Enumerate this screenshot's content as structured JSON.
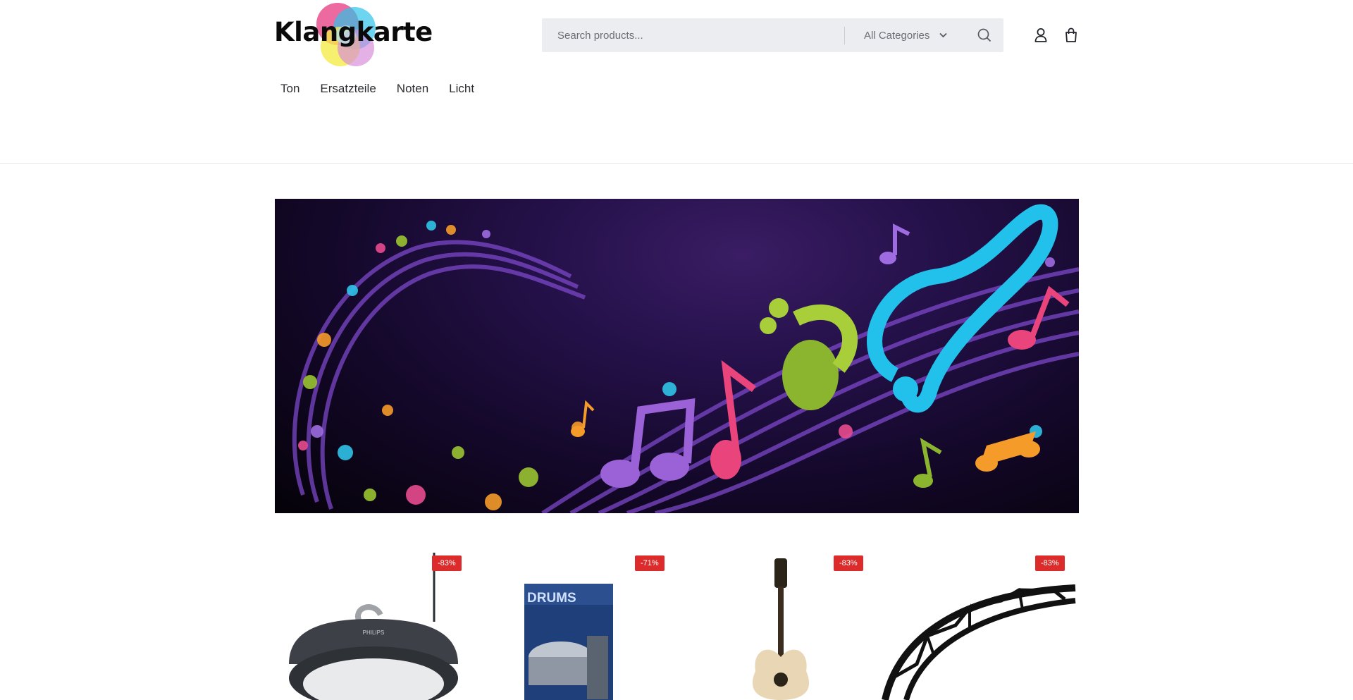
{
  "brand": {
    "name": "Klangkarte"
  },
  "search": {
    "placeholder": "Search products...",
    "category": "All Categories"
  },
  "icons": {
    "search": "search-icon",
    "account": "user-icon",
    "cart": "shopping-bag-icon",
    "dropdown": "chevron-down-icon"
  },
  "nav": {
    "items": [
      {
        "label": "Ton"
      },
      {
        "label": "Ersatzteile"
      },
      {
        "label": "Noten"
      },
      {
        "label": "Licht"
      }
    ]
  },
  "hero": {
    "theme": "colorful musical notes and treble clef on purple background"
  },
  "products": [
    {
      "discount": "-83%",
      "image": "industrial-led-high-bay-lamp"
    },
    {
      "discount": "-71%",
      "image": "drums-book-cover"
    },
    {
      "discount": "-83%",
      "image": "acoustic-guitar"
    },
    {
      "discount": "-83%",
      "image": "curved-truss-segment"
    }
  ],
  "colors": {
    "badge": "#dc2b2b",
    "search_bg": "#ebedf0",
    "hero_bg": "#1c0d3a",
    "text": "#1f2328"
  }
}
